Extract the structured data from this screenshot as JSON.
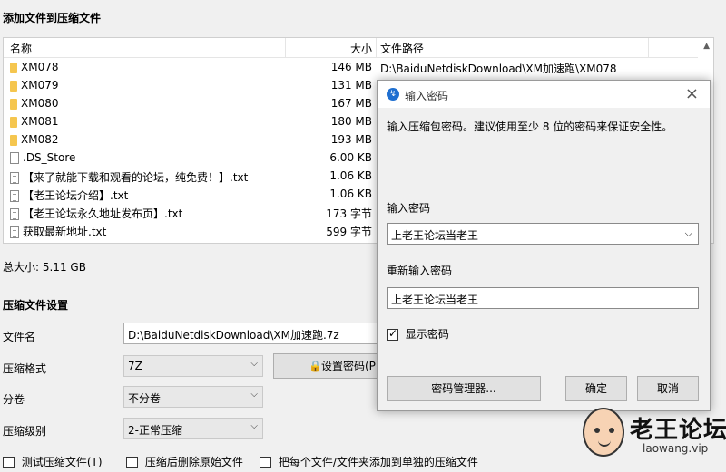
{
  "section_add_files": "添加文件到压缩文件",
  "file_list": {
    "columns": {
      "name": "名称",
      "size": "大小",
      "path": "文件路径"
    },
    "rows": [
      {
        "icon": "folder-icon",
        "name": "XM078",
        "size": "146 MB",
        "path": "D:\\BaiduNetdiskDownload\\XM加速跑\\XM078"
      },
      {
        "icon": "folder-icon",
        "name": "XM079",
        "size": "131 MB",
        "path": ""
      },
      {
        "icon": "folder-icon",
        "name": "XM080",
        "size": "167 MB",
        "path": ""
      },
      {
        "icon": "folder-icon",
        "name": "XM081",
        "size": "180 MB",
        "path": ""
      },
      {
        "icon": "folder-icon",
        "name": "XM082",
        "size": "193 MB",
        "path": ""
      },
      {
        "icon": "file-icon",
        "name": ".DS_Store",
        "size": "6.00 KB",
        "path": ""
      },
      {
        "icon": "text-file-icon",
        "name": "【来了就能下载和观看的论坛，纯免费！】.txt",
        "size": "1.06 KB",
        "path": ""
      },
      {
        "icon": "text-file-icon",
        "name": "【老王论坛介绍】.txt",
        "size": "1.06 KB",
        "path": ""
      },
      {
        "icon": "text-file-icon",
        "name": "【老王论坛永久地址发布页】.txt",
        "size": "173 字节",
        "path": ""
      },
      {
        "icon": "text-file-icon",
        "name": "获取最新地址.txt",
        "size": "599 字节",
        "path": ""
      }
    ]
  },
  "total_size": "总大小: 5.11 GB",
  "settings": {
    "heading": "压缩文件设置",
    "filename_label": "文件名",
    "filename_value": "D:\\BaiduNetdiskDownload\\XM加速跑.7z",
    "format_label": "压缩格式",
    "format_value": "7Z",
    "set_password_button": "设置密码(P)",
    "split_label": "分卷",
    "split_value": "不分卷",
    "level_label": "压缩级别",
    "level_value": "2-正常压缩",
    "test_checkbox": "测试压缩文件(T)",
    "delete_checkbox": "压缩后删除原始文件",
    "separate_checkbox": "把每个文件/文件夹添加到单独的压缩文件"
  },
  "dialog": {
    "title": "输入密码",
    "description": "输入压缩包密码。建议使用至少 8 位的密码来保证安全性。",
    "password_label": "输入密码",
    "password_value": "上老王论坛当老王",
    "reenter_label": "重新输入密码",
    "reenter_value": "上老王论坛当老王",
    "show_password_label": "显示密码",
    "show_password_checked": true,
    "manager_button": "密码管理器...",
    "ok_button": "确定",
    "cancel_button": "取消"
  },
  "watermark": {
    "title": "老王论坛",
    "url": "laowang.vip"
  }
}
